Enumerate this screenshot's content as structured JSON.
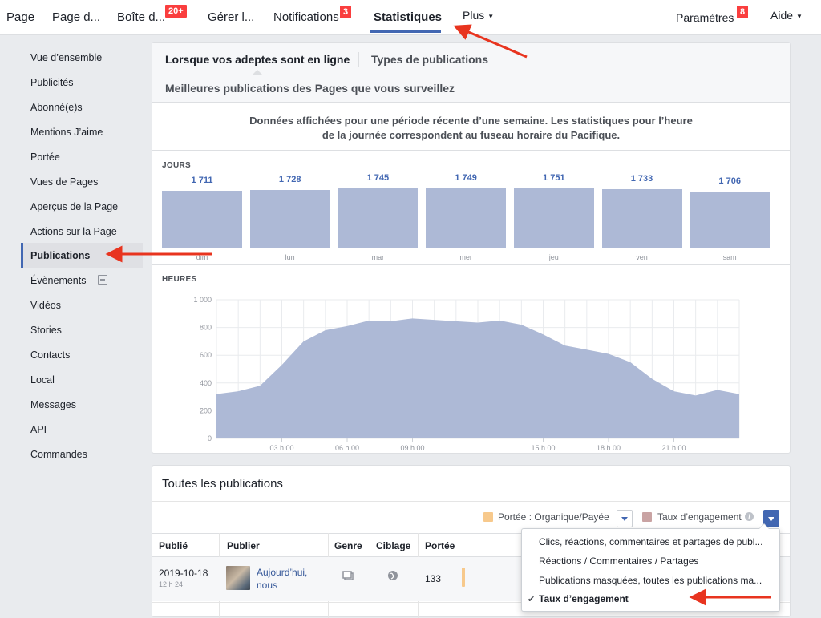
{
  "topnav": {
    "items": [
      {
        "label": "Page"
      },
      {
        "label": "Page d..."
      },
      {
        "label": "Boîte d...",
        "badge": "20+"
      },
      {
        "label": "Gérer l..."
      },
      {
        "label": "Notifications",
        "badge": "3"
      },
      {
        "label": "Statistiques"
      },
      {
        "label": "Plus"
      },
      {
        "label": "Paramètres",
        "badge": "8"
      },
      {
        "label": "Aide"
      }
    ]
  },
  "sidebar": {
    "items": [
      {
        "label": "Vue d’ensemble"
      },
      {
        "label": "Publicités"
      },
      {
        "label": "Abonné(e)s"
      },
      {
        "label": "Mentions J’aime"
      },
      {
        "label": "Portée"
      },
      {
        "label": "Vues de Pages"
      },
      {
        "label": "Aperçus de la Page"
      },
      {
        "label": "Actions sur la Page"
      },
      {
        "label": "Publications"
      },
      {
        "label": "Évènements"
      },
      {
        "label": "Vidéos"
      },
      {
        "label": "Stories"
      },
      {
        "label": "Contacts"
      },
      {
        "label": "Local"
      },
      {
        "label": "Messages"
      },
      {
        "label": "API"
      },
      {
        "label": "Commandes"
      }
    ]
  },
  "tabs": {
    "online": "Lorsque vos adeptes sont en ligne",
    "types": "Types de publications",
    "best": "Meilleures publications des Pages que vous surveillez"
  },
  "notice": "Données affichées pour une période récente d’une semaine. Les statistiques pour l’heure de la journée correspondent au fuseau horaire du Pacifique.",
  "chart_data": [
    {
      "type": "bar",
      "title": "JOURS",
      "categories": [
        "dim",
        "lun",
        "mar",
        "mer",
        "jeu",
        "ven",
        "sam"
      ],
      "values": [
        1711,
        1728,
        1745,
        1749,
        1751,
        1733,
        1706
      ],
      "labels": [
        "1 711",
        "1 728",
        "1 745",
        "1 749",
        "1 751",
        "1 733",
        "1 706"
      ],
      "color": "#adb9d6"
    },
    {
      "type": "area",
      "title": "HEURES",
      "ylim": [
        0,
        1000
      ],
      "yticks": [
        "0",
        "200",
        "400",
        "600",
        "800",
        "1 000"
      ],
      "xticks": [
        "03 h 00",
        "06 h 00",
        "09 h 00",
        "15 h 00",
        "18 h 00",
        "21 h 00"
      ],
      "xtick_hours": [
        3,
        6,
        9,
        15,
        18,
        21
      ],
      "x": [
        0,
        1,
        2,
        3,
        4,
        5,
        6,
        7,
        8,
        9,
        10,
        11,
        12,
        13,
        14,
        15,
        16,
        17,
        18,
        19,
        20,
        21,
        22,
        23
      ],
      "values": [
        320,
        340,
        380,
        530,
        700,
        780,
        810,
        850,
        845,
        865,
        855,
        845,
        835,
        850,
        820,
        750,
        670,
        640,
        610,
        550,
        430,
        340,
        310,
        350,
        320
      ],
      "color": "#adb9d6"
    }
  ],
  "posts": {
    "title": "Toutes les publications",
    "legend_reach": "Portée : Organique/Payée",
    "legend_engagement": "Taux d’engagement",
    "columns": [
      "Publié",
      "Publier",
      "Genre",
      "Ciblage",
      "Portée"
    ],
    "rows": [
      {
        "date": "2019-10-18",
        "time": "12 h 24",
        "text": "Aujourd’hui, nous",
        "reach": "133"
      }
    ]
  },
  "dropdown": {
    "items": [
      {
        "label": "Clics, réactions, commentaires et partages de publ..."
      },
      {
        "label": "Réactions / Commentaires / Partages"
      },
      {
        "label": "Publications masquées, toutes les publications ma..."
      },
      {
        "label": "Taux d’engagement",
        "selected": true
      }
    ]
  },
  "colors": {
    "accent": "#4267b2",
    "bar": "#adb9d6",
    "badge": "#fa3e3e",
    "annotation": "#e8341f",
    "reach_legend": "#f7c98c",
    "engagement_legend": "#c9a3a3"
  }
}
